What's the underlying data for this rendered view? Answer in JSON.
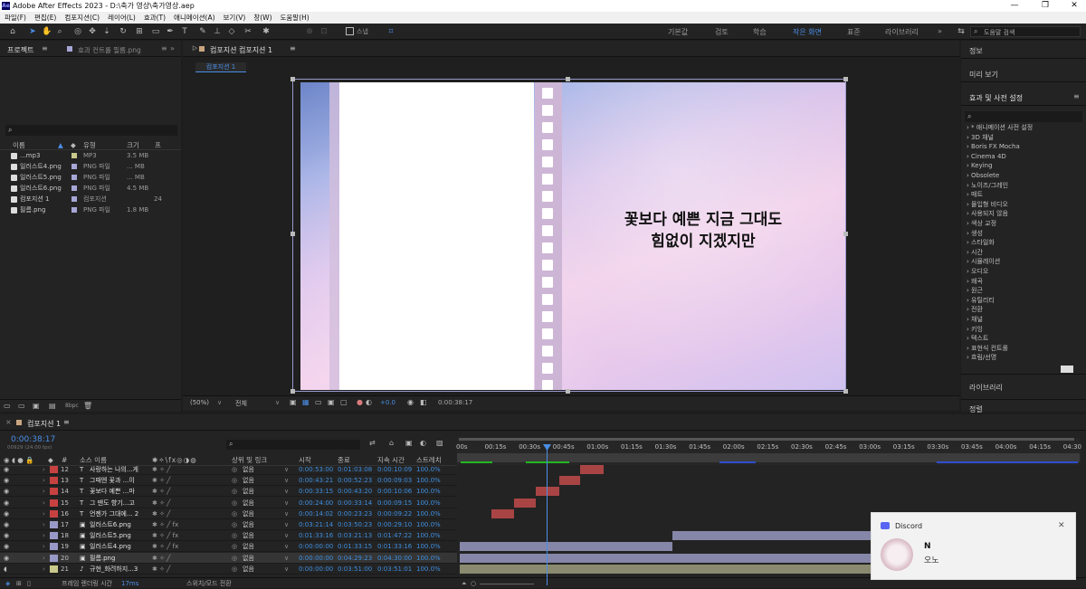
{
  "window": {
    "title": "Adobe After Effects 2023 - D:\\축가 영상\\축가영상.aep",
    "app_icon": "Ae",
    "controls": [
      "—",
      "❐",
      "✕"
    ]
  },
  "menu": [
    "파일(F)",
    "편집(E)",
    "컴포지션(C)",
    "레이어(L)",
    "효과(T)",
    "애니메이션(A)",
    "보기(V)",
    "창(W)",
    "도움말(H)"
  ],
  "toolbar": {
    "snap_label": "스냅",
    "workspaces": [
      "기본값",
      "검토",
      "학습",
      "작은 화면",
      "표준",
      "라이브러리"
    ],
    "active_workspace": "작은 화면",
    "help_search_placeholder": "도움말 검색",
    "more": "»"
  },
  "project_panel": {
    "tab_project": "프로젝트",
    "tab_effects": "효과 컨트롤 필름.png",
    "search_placeholder": "",
    "columns": {
      "name": "이름",
      "type": "유형",
      "size": "크기",
      "fr": "프"
    },
    "items": [
      {
        "name": "...mp3",
        "type": "MP3",
        "size": "3.5 MB",
        "fr": "",
        "icon": "audio-icon",
        "label_color": "#c9c98c"
      },
      {
        "name": "일러스트4.png",
        "type": "PNG 파일",
        "size": "... MB",
        "fr": "",
        "icon": "image-icon",
        "label_color": "#a6a6d6"
      },
      {
        "name": "일러스트5.png",
        "type": "PNG 파일",
        "size": "... MB",
        "fr": "",
        "icon": "image-icon",
        "label_color": "#a6a6d6"
      },
      {
        "name": "일러스트6.png",
        "type": "PNG 파일",
        "size": "4.5 MB",
        "fr": "",
        "icon": "image-icon",
        "label_color": "#a6a6d6"
      },
      {
        "name": "컴포지션 1",
        "type": "컴포지션",
        "size": "",
        "fr": "24",
        "icon": "composition-icon",
        "label_color": "#a6a6d6"
      },
      {
        "name": "필름.png",
        "type": "PNG 파일",
        "size": "1.8 MB",
        "fr": "",
        "icon": "image-icon",
        "label_color": "#a6a6d6"
      }
    ],
    "bpc": "8bpc"
  },
  "comp_panel": {
    "tab": "컴포지션 컴포지션 1",
    "breadcrumb": "컴포지션 1",
    "caption_line1": "꽃보다 예쁜 지금 그대도",
    "caption_line2": "힘없이 지겠지만",
    "zoom": "(50%)",
    "resolution": "전체",
    "exposure": "+0.0",
    "timecode": "0:00:38:17"
  },
  "right_panel": {
    "info": "정보",
    "preview": "미리 보기",
    "effects": "효과 및 사전 설정",
    "search_placeholder": "",
    "categories": [
      "* 애니메이션 사전 설정",
      "3D 채널",
      "Boris FX Mocha",
      "Cinema 4D",
      "Keying",
      "Obsolete",
      "노이즈/그레인",
      "매트",
      "몰입형 비디오",
      "사용되지 않음",
      "색상 교정",
      "생성",
      "스타일화",
      "시간",
      "시뮬레이션",
      "오디오",
      "왜곡",
      "원근",
      "유틸리티",
      "전환",
      "채널",
      "키잉",
      "텍스트",
      "표현식 컨트롤",
      "흐림/선명"
    ],
    "libraries": "라이브러리",
    "align": "정렬"
  },
  "timeline": {
    "tab": "컴포지션 1",
    "timecode": "0:00:38:17",
    "timecode_sub": "00929 (24.00 fps)",
    "search_placeholder": "",
    "columns": {
      "num": "#",
      "source": "소스 이름",
      "parent": "상위 및 링크",
      "in": "시작",
      "out": "종료",
      "dur": "지속 시간",
      "stretch": "스트레치"
    },
    "ruler": [
      "00s",
      "00:15s",
      "00:30s",
      "00:45s",
      "01:00s",
      "01:15s",
      "01:30s",
      "01:45s",
      "02:00s",
      "02:15s",
      "02:30s",
      "02:45s",
      "03:00s",
      "03:15s",
      "03:30s",
      "03:45s",
      "04:00s",
      "04:15s",
      "04:30"
    ],
    "layers": [
      {
        "num": "12",
        "type": "T",
        "name": "사랑하는 나의...게",
        "parent": "없음",
        "in": "0:00:53:00",
        "out": "0:01:03:08",
        "dur": "0:00:10:09",
        "stretch": "100.0%",
        "label_color": "#c84141"
      },
      {
        "num": "13",
        "type": "T",
        "name": "그때엔 꽃과 ...이",
        "parent": "없음",
        "in": "0:00:43:21",
        "out": "0:00:52:23",
        "dur": "0:00:09:03",
        "stretch": "100.0%",
        "label_color": "#c84141"
      },
      {
        "num": "14",
        "type": "T",
        "name": "꽃보다 예쁜 ...마",
        "parent": "없음",
        "in": "0:00:33:15",
        "out": "0:00:43:20",
        "dur": "0:00:10:06",
        "stretch": "100.0%",
        "label_color": "#c84141"
      },
      {
        "num": "15",
        "type": "T",
        "name": "그 땐도 향기...고",
        "parent": "없음",
        "in": "0:00:24:00",
        "out": "0:00:33:14",
        "dur": "0:00:09:15",
        "stretch": "100.0%",
        "label_color": "#c84141"
      },
      {
        "num": "16",
        "type": "T",
        "name": "언젠가 그대에... 2",
        "parent": "없음",
        "in": "0:00:14:02",
        "out": "0:00:23:23",
        "dur": "0:00:09:22",
        "stretch": "100.0%",
        "label_color": "#c84141"
      },
      {
        "num": "17",
        "type": "img",
        "name": "일러스트6.png",
        "parent": "없음",
        "in": "0:03:21:14",
        "out": "0:03:50:23",
        "dur": "0:00:29:10",
        "stretch": "100.0%",
        "label_color": "#9999c8"
      },
      {
        "num": "18",
        "type": "img",
        "name": "일러스트5.png",
        "parent": "없음",
        "in": "0:01:33:16",
        "out": "0:03:21:13",
        "dur": "0:01:47:22",
        "stretch": "100.0%",
        "label_color": "#9999c8"
      },
      {
        "num": "19",
        "type": "img",
        "name": "일러스트4.png",
        "parent": "없음",
        "in": "0:00:00:00",
        "out": "0:01:33:15",
        "dur": "0:01:33:16",
        "stretch": "100.0%",
        "label_color": "#9999c8"
      },
      {
        "num": "20",
        "type": "img",
        "name": "필름.png",
        "parent": "없음",
        "in": "0:00:00:00",
        "out": "0:04:29:23",
        "dur": "0:04:30:00",
        "stretch": "100.0%",
        "label_color": "#9999c8"
      },
      {
        "num": "21",
        "type": "aud",
        "name": "규현_화려하지...3",
        "parent": "없음",
        "in": "0:00:00:00",
        "out": "0:03:51:00",
        "dur": "0:03:51:01",
        "stretch": "100.0%",
        "label_color": "#c9c98c"
      }
    ],
    "footer_render": "프레임 렌더링 시간",
    "footer_render_val": "17ms",
    "footer_toggle": "스위치/모드 전환"
  },
  "notification": {
    "app": "Discord",
    "title": "N",
    "body": "오노"
  }
}
